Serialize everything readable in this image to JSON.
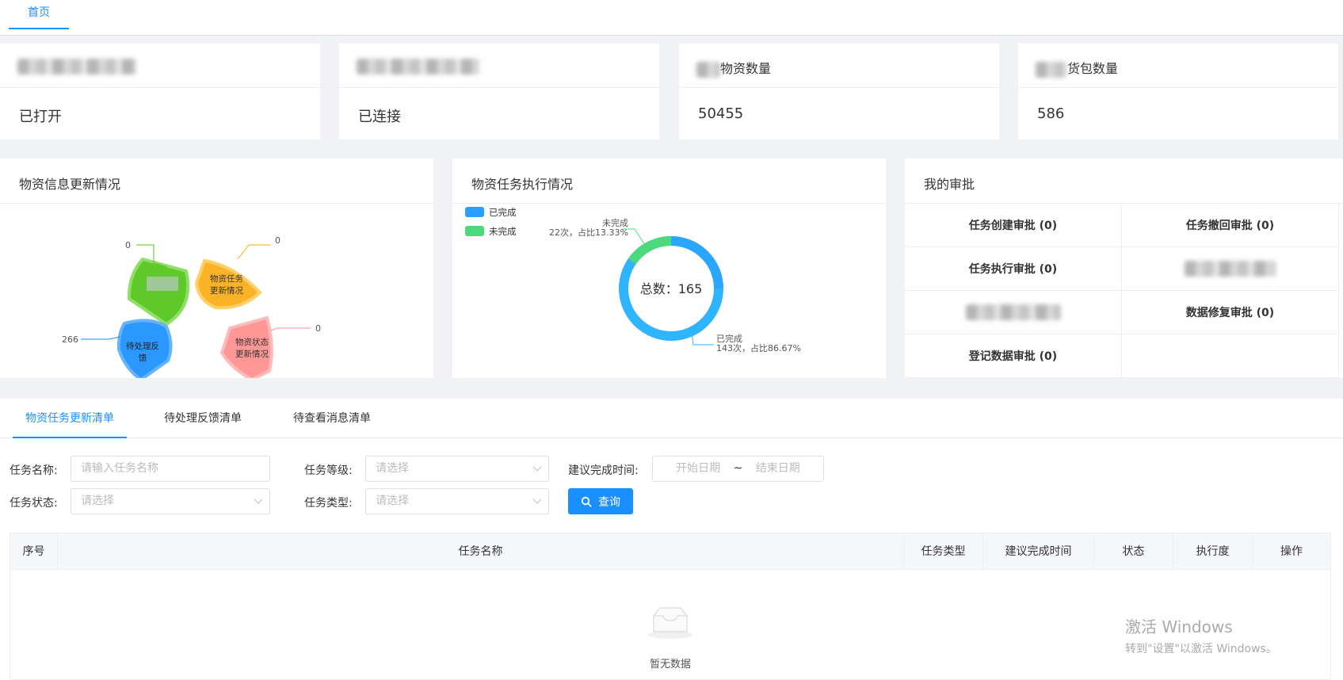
{
  "nav": {
    "home_tab": "首页"
  },
  "stats": [
    {
      "title": "",
      "value": "已打开"
    },
    {
      "title": "",
      "value": "已连接"
    },
    {
      "title": "物资数量",
      "value": "50455"
    },
    {
      "title": "货包数量",
      "value": "586"
    }
  ],
  "panels": {
    "material_update": {
      "title": "物资信息更新情况",
      "segments": [
        {
          "label": "",
          "value": "0",
          "color": "#52c41a"
        },
        {
          "label": "物资任务更新情况",
          "value": "0",
          "color": "#faad14"
        },
        {
          "label": "待处理反馈",
          "value": "266",
          "color": "#1890ff"
        },
        {
          "label": "物资状态更新情况",
          "value": "0",
          "color": "#ff8f8f"
        }
      ]
    },
    "task_exec": {
      "title": "物资任务执行情况",
      "legend": [
        "已完成",
        "未完成"
      ],
      "center_label": "总数：165",
      "done_label": "已完成",
      "done_detail": "143次，占比86.67%",
      "undone_label": "未完成",
      "undone_detail": "22次，占比13.33%"
    },
    "approvals": {
      "title": "我的审批",
      "items": [
        "任务创建审批 (0)",
        "任务撤回审批 (0)",
        "任务执行审批 (0)",
        "",
        "",
        "数据修复审批 (0)",
        "登记数据审批 (0)",
        ""
      ]
    }
  },
  "list": {
    "tabs": [
      "物资任务更新清单",
      "待处理反馈清单",
      "待查看消息清单"
    ],
    "filters": {
      "task_name_label": "任务名称:",
      "task_name_placeholder": "请输入任务名称",
      "task_level_label": "任务等级:",
      "task_level_placeholder": "请选择",
      "suggest_time_label": "建议完成时间:",
      "start_date": "开始日期",
      "date_sep": "~",
      "end_date": "结束日期",
      "task_status_label": "任务状态:",
      "task_status_placeholder": "请选择",
      "task_type_label": "任务类型:",
      "task_type_placeholder": "请选择",
      "query_button": "查询"
    },
    "columns": [
      "序号",
      "任务名称",
      "任务类型",
      "建议完成时间",
      "状态",
      "执行度",
      "操作"
    ],
    "empty_text": "暂无数据"
  },
  "watermark": {
    "line1": "激活 Windows",
    "line2": "转到\"设置\"以激活 Windows。"
  },
  "colors": {
    "primary": "#1890ff",
    "done": "#2a9fff",
    "undone": "#4cd97b"
  }
}
